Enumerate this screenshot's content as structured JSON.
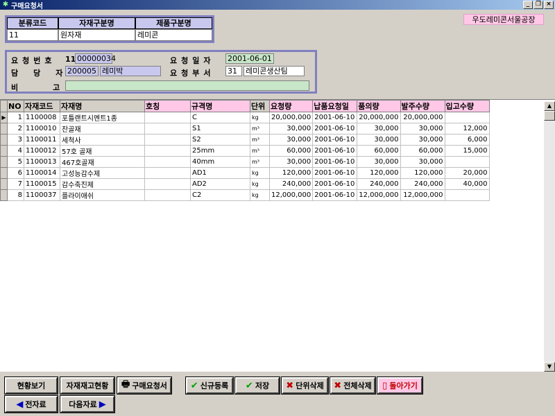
{
  "window": {
    "title": "구매요청서",
    "minimize": "_",
    "restore": "❐",
    "close": "×"
  },
  "factory": "우도레미콘서울공장",
  "classification": {
    "headers": [
      "분류코드",
      "자재구분명",
      "제품구분명"
    ],
    "values": [
      "11",
      "원자재",
      "레미콘"
    ]
  },
  "request": {
    "labels": {
      "request_no": "요청번호",
      "manager": "담당자",
      "remark": "비고",
      "request_date": "요청일자",
      "request_dept": "요청부서"
    },
    "request_no_prefix": "11",
    "request_no": "00000034",
    "manager_code": "200005",
    "manager_name": "레미박",
    "request_date": "2001-06-01",
    "dept_code": "31",
    "dept_name": "레미콘생산팀",
    "remark": ""
  },
  "grid": {
    "headers": [
      "NO",
      "자재코드",
      "자재명",
      "호칭",
      "규격명",
      "단위",
      "요청량",
      "납품요청일",
      "품의량",
      "발주수량",
      "입고수량"
    ],
    "rows": [
      {
        "no": "1",
        "code": "1100008",
        "name": "포틀랜트시멘트1종",
        "nick": "",
        "spec": "C",
        "unit": "kg",
        "req": "20,000,000",
        "date": "2001-06-10",
        "approved": "20,000,000",
        "order": "20,000,000",
        "recv": ""
      },
      {
        "no": "2",
        "code": "1100010",
        "name": "잔골재",
        "nick": "",
        "spec": "S1",
        "unit": "m³",
        "req": "30,000",
        "date": "2001-06-10",
        "approved": "30,000",
        "order": "30,000",
        "recv": "12,000"
      },
      {
        "no": "3",
        "code": "1100011",
        "name": "세척사",
        "nick": "",
        "spec": "S2",
        "unit": "m³",
        "req": "30,000",
        "date": "2001-06-10",
        "approved": "30,000",
        "order": "30,000",
        "recv": "6,000"
      },
      {
        "no": "4",
        "code": "1100012",
        "name": "57호 골재",
        "nick": "",
        "spec": "25mm",
        "unit": "m³",
        "req": "60,000",
        "date": "2001-06-10",
        "approved": "60,000",
        "order": "60,000",
        "recv": "15,000"
      },
      {
        "no": "5",
        "code": "1100013",
        "name": "467호골재",
        "nick": "",
        "spec": "40mm",
        "unit": "m³",
        "req": "30,000",
        "date": "2001-06-10",
        "approved": "30,000",
        "order": "30,000",
        "recv": ""
      },
      {
        "no": "6",
        "code": "1100014",
        "name": "고성능감수제",
        "nick": "",
        "spec": "AD1",
        "unit": "kg",
        "req": "120,000",
        "date": "2001-06-10",
        "approved": "120,000",
        "order": "120,000",
        "recv": "20,000"
      },
      {
        "no": "7",
        "code": "1100015",
        "name": "감수축진제",
        "nick": "",
        "spec": "AD2",
        "unit": "kg",
        "req": "240,000",
        "date": "2001-06-10",
        "approved": "240,000",
        "order": "240,000",
        "recv": "40,000"
      },
      {
        "no": "8",
        "code": "1100037",
        "name": "플라이애쉬",
        "nick": "",
        "spec": "C2",
        "unit": "kg",
        "req": "12,000,000",
        "date": "2001-06-10",
        "approved": "12,000,000",
        "order": "12,000,000",
        "recv": ""
      }
    ]
  },
  "buttons": {
    "status_view": "현황보기",
    "stock_status": "자재재고현황",
    "print_request": "구매요청서",
    "new": "신규등록",
    "save": "저장",
    "delete_unit": "단위삭제",
    "delete_all": "전체삭제",
    "back": "돌아가기",
    "prev": "전자료",
    "next": "다음자료"
  },
  "colors": {
    "header_pink": "#ffc8e6",
    "field_blue": "#c8c8ee",
    "field_green": "#c8e6c8",
    "frame_purple": "#8080c0"
  }
}
